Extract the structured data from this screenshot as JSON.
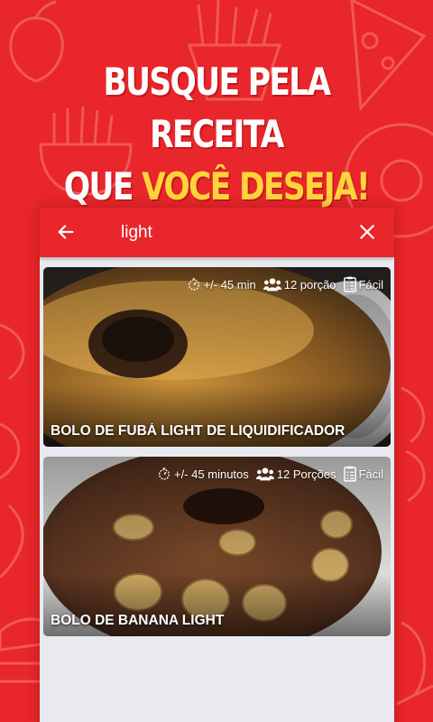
{
  "promo": {
    "line1": "BUSQUE PELA RECEITA",
    "line2_plain": "QUE ",
    "line2_highlight": "VOCÊ DESEJA!"
  },
  "colors": {
    "brand_red": "#e8262b",
    "highlight_yellow": "#ffd43b",
    "list_background": "#e9eaf0"
  },
  "search": {
    "back_icon": "arrow-left-icon",
    "query": "light",
    "clear_icon": "close-icon"
  },
  "recipes": [
    {
      "title": "BOLO DE FUBÁ LIGHT DE LIQUIDIFICADOR",
      "time": "+/- 45 min",
      "servings": "12 porção",
      "difficulty": "Fácil"
    },
    {
      "title": "BOLO DE BANANA LIGHT",
      "time": "+/- 45 minutos",
      "servings": "12 Porções",
      "difficulty": "Fácil"
    }
  ]
}
